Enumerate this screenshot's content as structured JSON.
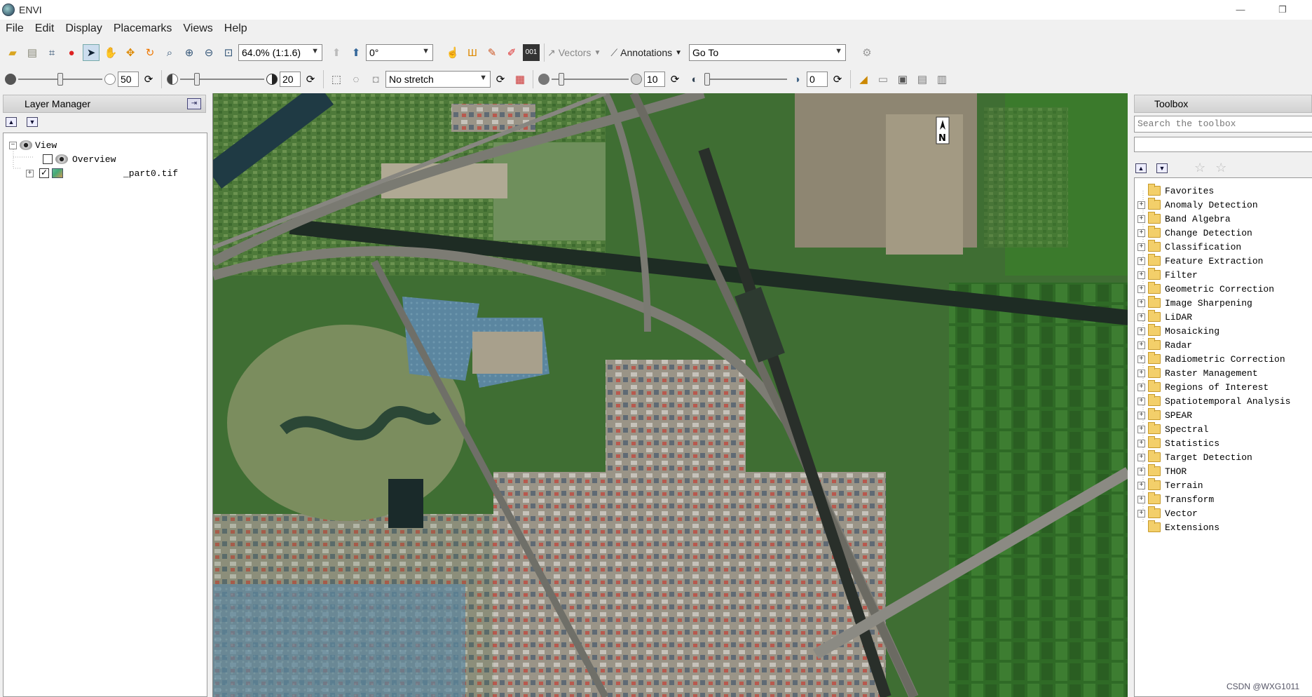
{
  "window": {
    "title": "ENVI"
  },
  "menu": [
    "File",
    "Edit",
    "Display",
    "Placemarks",
    "Views",
    "Help"
  ],
  "toolbar1": {
    "zoom_value": "64.0% (1:1.6)",
    "rotation_value": "0°",
    "vectors_label": "Vectors",
    "annotations_label": "Annotations",
    "goto_placeholder": "Go To"
  },
  "toolbar2": {
    "brightness_value": "50",
    "contrast_value": "20",
    "stretch_value": "No stretch",
    "sharpen_value": "10",
    "transparency_value": "0"
  },
  "layer_manager": {
    "title": "Layer Manager",
    "tree": [
      {
        "label": "View"
      },
      {
        "label": "Overview",
        "checked": false
      },
      {
        "label": "_part0.tif",
        "checked": true
      }
    ]
  },
  "map": {
    "north_label": "N"
  },
  "toolbox": {
    "title": "Toolbox",
    "search_placeholder": "Search the toolbox",
    "items": [
      "Favorites",
      "Anomaly Detection",
      "Band Algebra",
      "Change Detection",
      "Classification",
      "Feature Extraction",
      "Filter",
      "Geometric Correction",
      "Image Sharpening",
      "LiDAR",
      "Mosaicking",
      "Radar",
      "Radiometric Correction",
      "Raster Management",
      "Regions of Interest",
      "Spatiotemporal Analysis",
      "SPEAR",
      "Spectral",
      "Statistics",
      "Target Detection",
      "THOR",
      "Terrain",
      "Transform",
      "Vector",
      "Extensions"
    ]
  },
  "watermark": "CSDN @WXG1011",
  "colors": {
    "accent": "#cddeee",
    "folder": "#f3cf6a"
  }
}
